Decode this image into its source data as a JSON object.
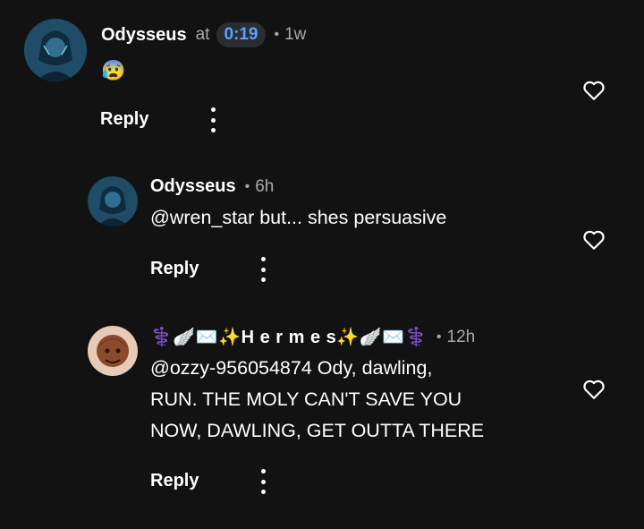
{
  "comments": [
    {
      "author": "Odysseus",
      "at_label": "at",
      "timestamp": "0:19",
      "separator": "•",
      "age": "1w",
      "text": "😰",
      "reply_label": "Reply"
    },
    {
      "author": "Odysseus",
      "separator": "•",
      "age": "6h",
      "text": "@wren_star but... shes persuasive",
      "reply_label": "Reply"
    },
    {
      "author": "⚕️🪽✉️✨H e r m e s✨🪽✉️⚕️",
      "separator": "•",
      "age": "12h",
      "text_lines": [
        "@ozzy-956054874 Ody, dawling,",
        "RUN. THE MOLY CAN'T SAVE YOU",
        "NOW, DAWLING, GET OUTTA THERE"
      ],
      "reply_label": "Reply"
    }
  ],
  "colors": {
    "background": "#121212",
    "timestamp_accent": "#5aa2ff",
    "muted": "#a9a9a9"
  },
  "icons": [
    "avatar",
    "heart-outline-icon",
    "more-vertical-icon"
  ]
}
